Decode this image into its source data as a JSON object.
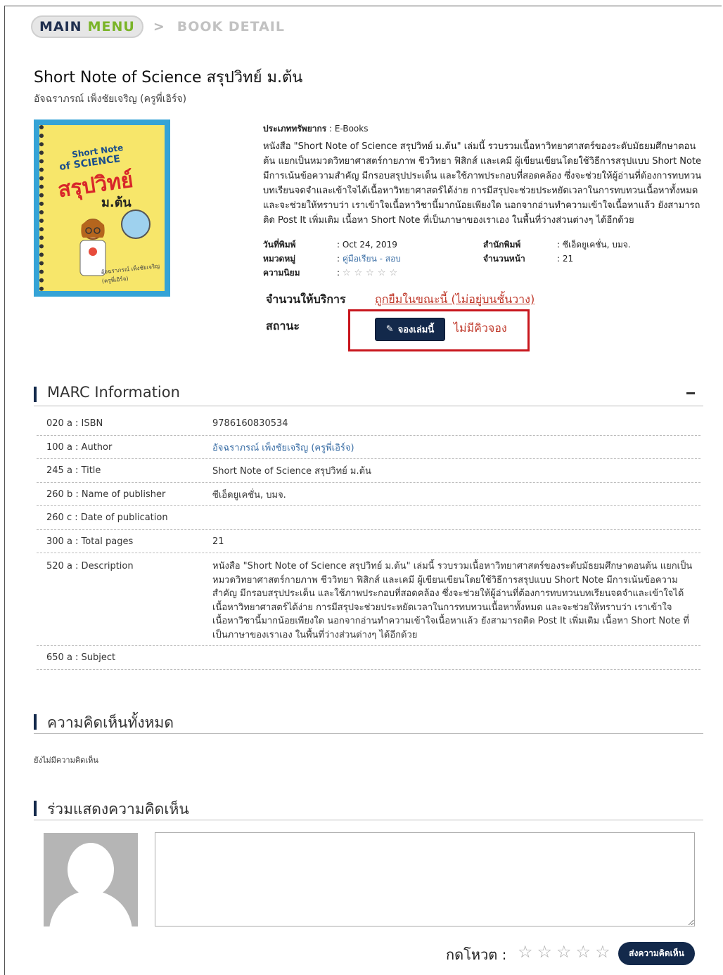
{
  "breadcrumb": {
    "main_word1": "MAIN",
    "main_word2": "MENU",
    "separator": ">",
    "current": "BOOK DETAIL"
  },
  "book": {
    "title": "Short Note of Science สรุปวิทย์ ม.ต้น",
    "author": "อัจฉราภรณ์ เพ็งชัยเจริญ (ครูพี่เอิร์จ)",
    "cover": {
      "line1": "Short Note",
      "line2": "of SCIENCE",
      "line3": "สรุปวิทย์",
      "line4": "ม.ต้น",
      "author_caption": "อัจฉราภรณ์ เพ็งชัยเจริญ (ครูพี่เอิร์จ)"
    },
    "resource_type_label": "ประเภททรัพยากร",
    "resource_type_value": ": E-Books",
    "description": "หนังสือ \"Short Note of Science สรุปวิทย์ ม.ต้น\" เล่มนี้ รวบรวมเนื้อหาวิทยาศาสตร์ของระดับมัธยมศึกษาตอนต้น แยกเป็นหมวดวิทยาศาสตร์กายภาพ ชีววิทยา ฟิสิกส์ และเคมี ผู้เขียนเขียนโดยใช้วิธีการสรุปแบบ Short Note มีการเน้นข้อความสำคัญ มีกรอบสรุปประเด็น และใช้ภาพประกอบที่สอดคล้อง ซึ่งจะช่วยให้ผู้อ่านที่ต้องการทบทวนบทเรียนจดจำและเข้าใจได้เนื้อหาวิทยาศาสตร์ได้ง่าย การมีสรุปจะช่วยประหยัดเวลาในการทบทวนเนื้อหาทั้งหมด และจะช่วยให้ทราบว่า เราเข้าใจเนื้อหาวิชานี้มากน้อยเพียงใด นอกจากอ่านทำความเข้าใจเนื้อหาแล้ว ยังสามารถติด Post It เพิ่มเติม เนื้อหา Short Note ที่เป็นภาษาของเราเอง ในพื้นที่ว่างส่วนต่างๆ ได้อีกด้วย",
    "pub_date_label": "วันที่พิมพ์",
    "pub_date_value": ": Oct 24, 2019",
    "publisher_label": "สำนักพิมพ์",
    "publisher_value": ": ซีเอ็ดยูเคชั่น, บมจ.",
    "category_label": "หมวดหมู่",
    "category_value": "คู่มือเรียน - สอบ",
    "category_prefix": ": ",
    "pages_label": "จำนวนหน้า",
    "pages_value": ": 21",
    "popularity_label": "ความนิยม",
    "popularity_prefix": ":",
    "popularity_stars": 0,
    "availability_label": "จำนวนให้บริการ",
    "availability_value": "ถูกยืมในขณะนี้ (ไม่อยู่บนชั้นวาง)",
    "status_label": "สถานะ",
    "reserve_button": "จองเล่มนี้",
    "queue_status": "ไม่มีคิวจอง"
  },
  "marc": {
    "title": "MARC Information",
    "rows": [
      {
        "k": "020 a : ISBN",
        "v": "9786160830534"
      },
      {
        "k": "100 a : Author",
        "v": "อัจฉราภรณ์ เพ็งชัยเจริญ (ครูพี่เอิร์จ)"
      },
      {
        "k": "245 a : Title",
        "v": "Short Note of Science สรุปวิทย์ ม.ต้น"
      },
      {
        "k": "260 b : Name of publisher",
        "v": "ซีเอ็ดยูเคชั่น, บมจ."
      },
      {
        "k": "260 c : Date of publication",
        "v": ""
      },
      {
        "k": "300 a : Total pages",
        "v": "21"
      },
      {
        "k": "520 a : Description",
        "v": "หนังสือ \"Short Note of Science สรุปวิทย์ ม.ต้น\" เล่มนี้ รวบรวมเนื้อหาวิทยาศาสตร์ของระดับมัธยมศึกษาตอนต้น แยกเป็นหมวดวิทยาศาสตร์กายภาพ ชีววิทยา ฟิสิกส์ และเคมี ผู้เขียนเขียนโดยใช้วิธีการสรุปแบบ Short Note มีการเน้นข้อความสำคัญ มีกรอบสรุปประเด็น และใช้ภาพประกอบที่สอดคล้อง ซึ่งจะช่วยให้ผู้อ่านที่ต้องการทบทวนบทเรียนจดจำและเข้าใจได้เนื้อหาวิทยาศาสตร์ได้ง่าย การมีสรุปจะช่วยประหยัดเวลาในการทบทวนเนื้อหาทั้งหมด และจะช่วยให้ทราบว่า เราเข้าใจเนื้อหาวิชานี้มากน้อยเพียงใด นอกจากอ่านทำความเข้าใจเนื้อหาแล้ว ยังสามารถติด Post It เพิ่มเติม เนื้อหา Short Note ที่เป็นภาษาของเราเอง ในพื้นที่ว่างส่วนต่างๆ ได้อีกด้วย"
      },
      {
        "k": "650 a : Subject",
        "v": ""
      }
    ]
  },
  "comments": {
    "title": "ความคิดเห็นทั้งหมด",
    "empty": "ยังไม่มีความคิดเห็น"
  },
  "compose": {
    "title": "ร่วมแสดงความคิดเห็น",
    "textarea_value": "",
    "vote_label": "กดโหวต :",
    "vote_stars": 0,
    "submit": "ส่งความคิดเห็น"
  },
  "colors": {
    "navy": "#13294b",
    "green": "#7ab428",
    "red": "#c0392b",
    "link": "#3a6ea5"
  }
}
